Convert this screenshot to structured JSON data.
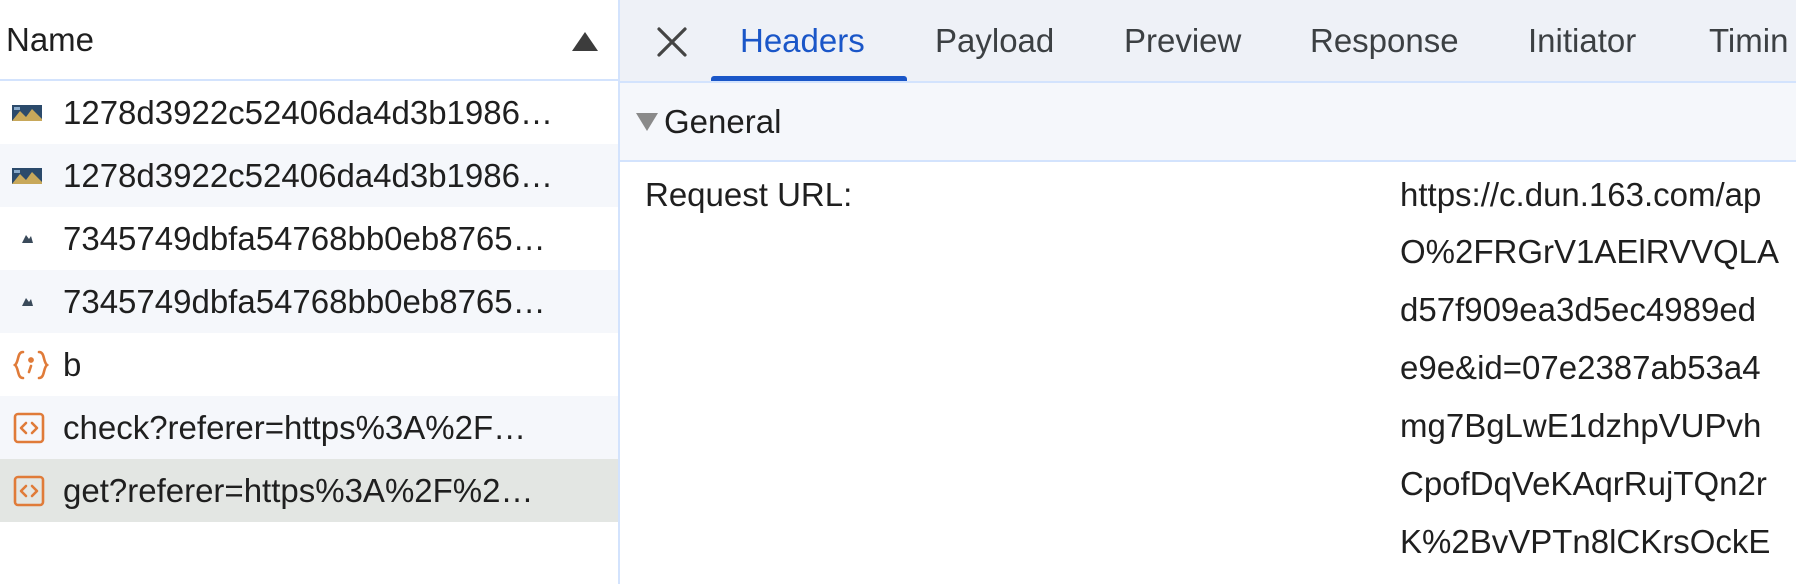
{
  "left_panel": {
    "column_header": "Name",
    "rows": [
      {
        "name": "1278d3922c52406da4d3b1986…",
        "icon": "image-thumbnail-icon"
      },
      {
        "name": "1278d3922c52406da4d3b1986…",
        "icon": "image-thumbnail-icon"
      },
      {
        "name": "7345749dbfa54768bb0eb8765…",
        "icon": "image-thumbnail-small-icon"
      },
      {
        "name": "7345749dbfa54768bb0eb8765…",
        "icon": "image-thumbnail-small-icon"
      },
      {
        "name": "b",
        "icon": "script-braces-icon"
      },
      {
        "name": "check?referer=https%3A%2F…",
        "icon": "document-code-icon"
      },
      {
        "name": "get?referer=https%3A%2F%2…",
        "icon": "document-code-icon"
      }
    ]
  },
  "tabs": [
    "Headers",
    "Payload",
    "Preview",
    "Response",
    "Initiator",
    "Timin"
  ],
  "active_tab": "Headers",
  "general": {
    "title": "General",
    "request_url_label": "Request URL:",
    "request_url_lines": [
      "https://c.dun.163.com/ap",
      "O%2FRGrV1AElRVVQLA",
      "d57f909ea3d5ec4989ed",
      "e9e&id=07e2387ab53a4",
      "mg7BgLwE1dzhpVUPvh",
      "CpofDqVeKAqrRujTQn2r",
      "K%2BvVPTn8lCKrsOckE"
    ]
  },
  "colors": {
    "accent": "#1a56c8",
    "icon_orange": "#e07b39",
    "border": "#d3e3fd"
  }
}
